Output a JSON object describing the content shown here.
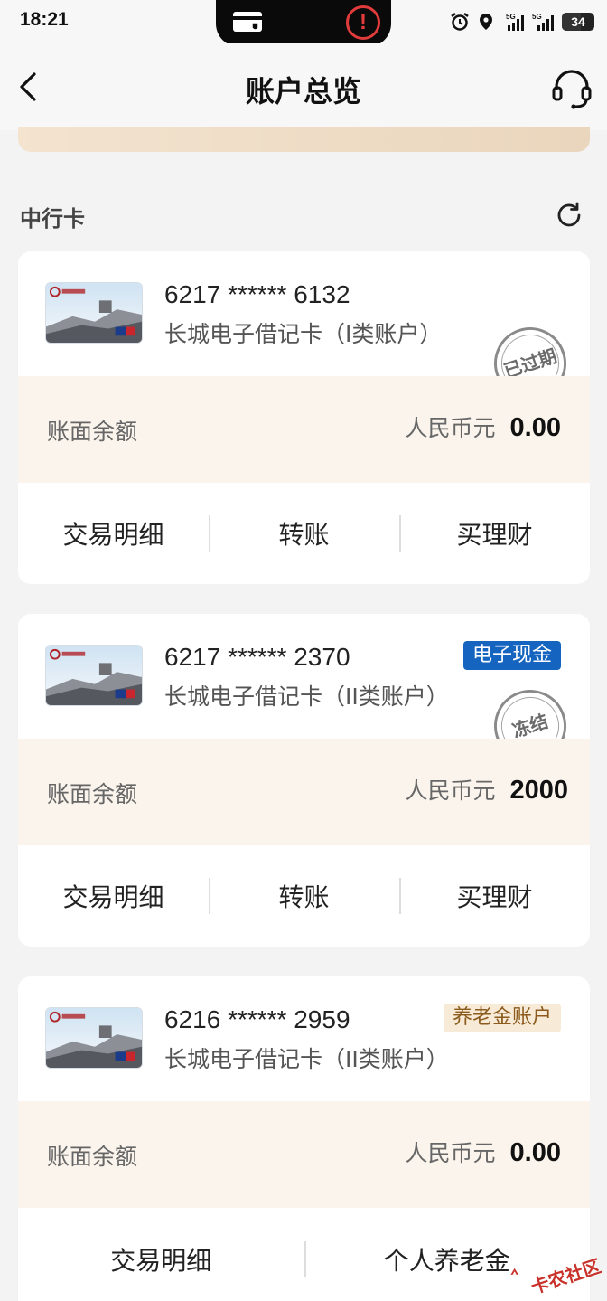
{
  "status_bar": {
    "time": "18:21",
    "battery": "34",
    "icons": [
      "wallet-card-icon",
      "alert-icon",
      "alarm-icon",
      "location-icon",
      "signal-5g-icon",
      "signal-5g-icon",
      "battery-icon"
    ]
  },
  "header": {
    "title": "账户总览",
    "back_icon": "chevron-left-icon",
    "support_icon": "headset-icon"
  },
  "section": {
    "title": "中行卡",
    "refresh_icon": "refresh-icon"
  },
  "colors": {
    "background": "#f3f3f3",
    "balance_bg": "#faf4ec",
    "tag_blue": "#1565c0",
    "tag_gold_bg": "#f7ead6",
    "tag_gold_text": "#8b5a1c"
  },
  "accounts": [
    {
      "number": "6217 ****** 6132",
      "type": "长城电子借记卡（I类账户）",
      "stamp": "已过期",
      "balance_label": "账面余额",
      "currency": "人民币元",
      "amount": "0.00",
      "actions": [
        "交易明细",
        "转账",
        "买理财"
      ]
    },
    {
      "number": "6217 ****** 2370",
      "type": "长城电子借记卡（II类账户）",
      "tag": "电子现金",
      "stamp": "冻结",
      "balance_label": "账面余额",
      "currency": "人民币元",
      "amount": "2000",
      "actions": [
        "交易明细",
        "转账",
        "买理财"
      ]
    },
    {
      "number": "6216 ****** 2959",
      "type": "长城电子借记卡（II类账户）",
      "tag": "养老金账户",
      "balance_label": "账面余额",
      "currency": "人民币元",
      "amount": "0.00",
      "actions": [
        "交易明细",
        "个人养老金"
      ]
    }
  ],
  "watermark": "卡农社区"
}
